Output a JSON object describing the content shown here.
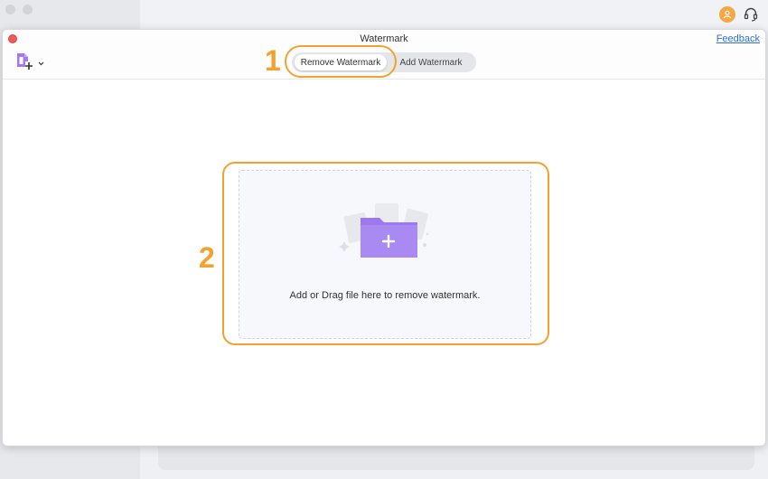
{
  "window": {
    "title": "Watermark",
    "feedback_link": "Feedback"
  },
  "tabs": [
    {
      "label": "Remove Watermark",
      "active": true
    },
    {
      "label": "Add Watermark",
      "active": false
    }
  ],
  "drop_zone": {
    "text": "Add or Drag file here to remove watermark."
  },
  "annotations": {
    "step1": "1",
    "step2": "2",
    "color": "#f3a12f"
  },
  "colors": {
    "accent_purple": "#a678f0",
    "link_blue": "#2d6fd6",
    "close_red": "#f05b57",
    "user_orange": "#f4a844"
  },
  "icons": {
    "add_file": "add-file-icon",
    "dropdown": "chevron-down-icon",
    "user": "user-icon",
    "support": "headset-icon",
    "folder": "folder-plus-icon"
  }
}
